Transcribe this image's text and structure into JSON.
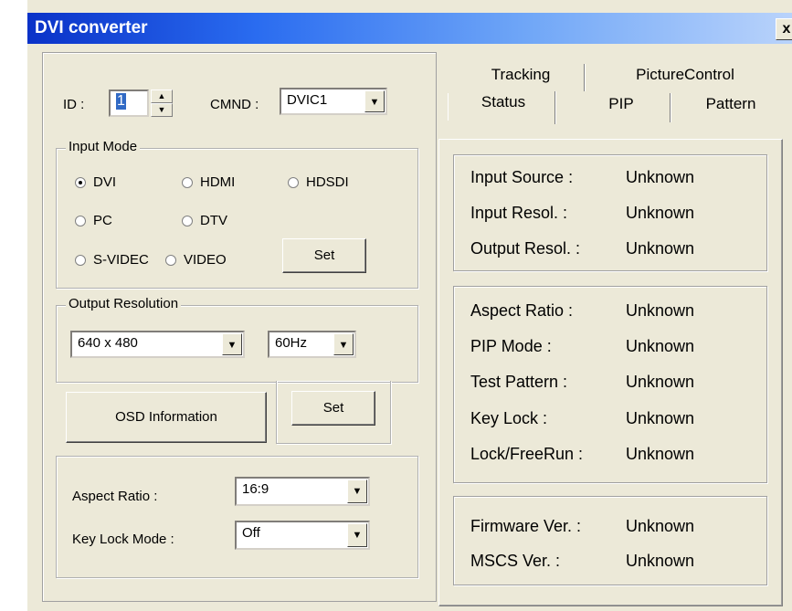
{
  "window": {
    "title": "DVI converter",
    "close_label": "x"
  },
  "id_field": {
    "label": "ID :",
    "value": "1"
  },
  "cmnd": {
    "label": "CMND :",
    "value": "DVIC1"
  },
  "input_mode": {
    "title": "Input Mode",
    "options": [
      "DVI",
      "HDMI",
      "HDSDI",
      "PC",
      "DTV",
      "S-VIDEC",
      "VIDEO"
    ],
    "selected": "DVI",
    "set_label": "Set"
  },
  "output_resolution": {
    "title": "Output Resolution",
    "resolution": "640 x 480",
    "refresh": "60Hz"
  },
  "osd": {
    "label": "OSD  Information",
    "set_label": "Set"
  },
  "aspect": {
    "label": "Aspect Ratio :",
    "value": "16:9"
  },
  "keylock": {
    "label": "Key Lock Mode :",
    "value": "Off"
  },
  "tabs": {
    "row1": [
      "Tracking",
      "PictureControl"
    ],
    "row2": [
      "Status",
      "PIP",
      "Pattern"
    ],
    "active": "Status"
  },
  "status": {
    "group1": [
      {
        "label": "Input Source :",
        "value": "Unknown"
      },
      {
        "label": "Input Resol. :",
        "value": "Unknown"
      },
      {
        "label": "Output Resol. :",
        "value": "Unknown"
      }
    ],
    "group2": [
      {
        "label": "Aspect Ratio :",
        "value": "Unknown"
      },
      {
        "label": "PIP Mode :",
        "value": "Unknown"
      },
      {
        "label": "Test Pattern :",
        "value": "Unknown"
      },
      {
        "label": "Key Lock :",
        "value": "Unknown"
      },
      {
        "label": "Lock/FreeRun :",
        "value": "Unknown"
      }
    ],
    "group3": [
      {
        "label": "Firmware Ver. :",
        "value": "Unknown"
      },
      {
        "label": "MSCS Ver. :",
        "value": "Unknown"
      }
    ]
  },
  "colors": {
    "titlebar_start": "#0a32c8",
    "titlebar_end": "#b9d3fb",
    "dialog_bg": "#ece9d8"
  }
}
